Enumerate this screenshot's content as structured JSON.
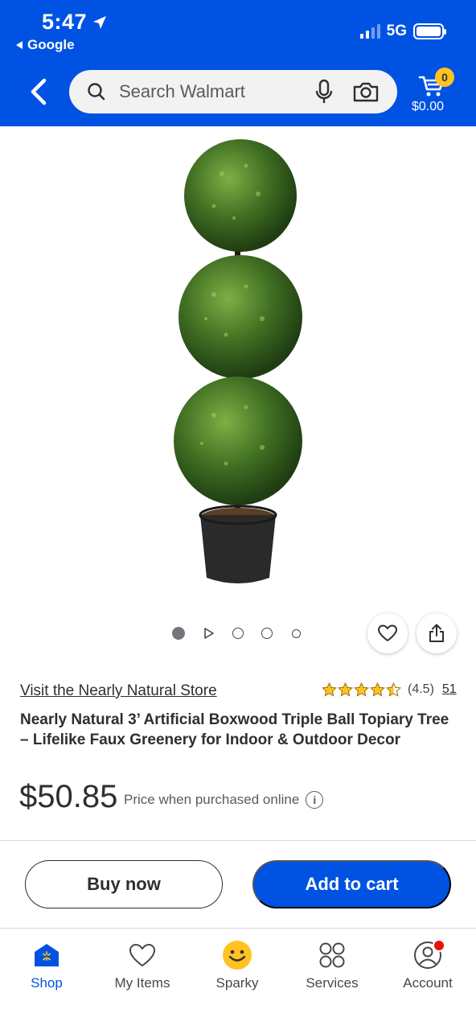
{
  "status_bar": {
    "time": "5:47",
    "back_app": "Google",
    "network": "5G"
  },
  "header": {
    "search_placeholder": "Search Walmart",
    "cart_count": "0",
    "cart_total": "$0.00",
    "brand_color": "#0053e2"
  },
  "carousel": {
    "items": [
      "image",
      "video",
      "image",
      "image",
      "image"
    ],
    "active_index": 0
  },
  "product": {
    "store_link": "Visit the Nearly Natural Store",
    "rating_stars": 4.5,
    "rating_value": "(4.5)",
    "review_count": "51",
    "title": "Nearly Natural 3’ Artificial Boxwood Triple Ball Topiary Tree – Lifelike Faux Greenery for Indoor & Outdoor Decor",
    "price": "$50.85",
    "price_note": "Price when purchased online"
  },
  "actions": {
    "buy_now": "Buy now",
    "add_to_cart": "Add to cart"
  },
  "tabbar": {
    "items": [
      {
        "label": "Shop",
        "icon": "shop-icon",
        "active": true
      },
      {
        "label": "My Items",
        "icon": "heart-icon",
        "active": false
      },
      {
        "label": "Sparky",
        "icon": "sparky-icon",
        "active": false
      },
      {
        "label": "Services",
        "icon": "services-icon",
        "active": false
      },
      {
        "label": "Account",
        "icon": "account-icon",
        "active": false
      }
    ]
  }
}
